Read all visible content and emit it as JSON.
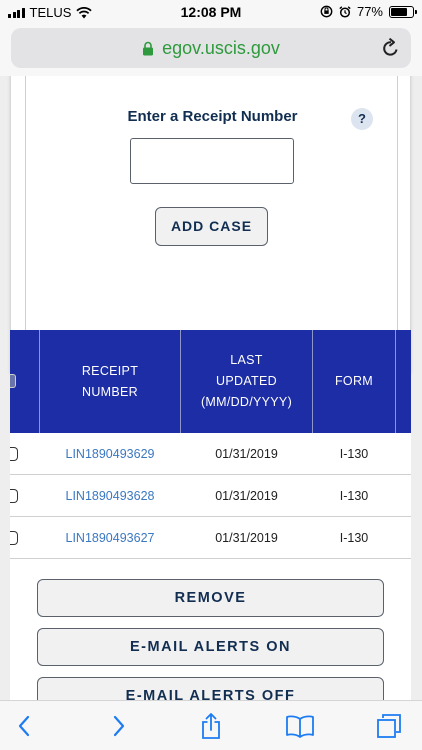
{
  "status_bar": {
    "carrier": "TELUS",
    "time": "12:08 PM",
    "battery_percent": "77%",
    "battery_level": 0.77
  },
  "browser": {
    "url": "egov.uscis.gov",
    "lock_icon": "lock-icon",
    "reload_icon": "reload-icon"
  },
  "add_case": {
    "label": "Enter a Receipt Number",
    "help": "?",
    "input_value": "",
    "button_label": "ADD CASE"
  },
  "table": {
    "headers": {
      "receipt_line1": "RECEIPT",
      "receipt_line2": "NUMBER",
      "updated_line1": "LAST",
      "updated_line2": "UPDATED",
      "updated_line3": "(MM/DD/YYYY)",
      "form": "FORM"
    },
    "rows": [
      {
        "receipt": "LIN1890493629",
        "updated": "01/31/2019",
        "form": "I-130"
      },
      {
        "receipt": "LIN1890493628",
        "updated": "01/31/2019",
        "form": "I-130"
      },
      {
        "receipt": "LIN1890493627",
        "updated": "01/31/2019",
        "form": "I-130"
      }
    ]
  },
  "actions": {
    "remove": "REMOVE",
    "email_on": "E-MAIL ALERTS ON",
    "email_off": "E-MAIL ALERTS OFF"
  },
  "toolbar": {
    "icons": [
      "back-icon",
      "forward-icon",
      "share-icon",
      "bookmarks-icon",
      "tabs-icon"
    ]
  },
  "colors": {
    "header_blue": "#1c2da6",
    "link_blue": "#3a78c2",
    "navy_text": "#112e51",
    "url_green": "#2e9a3d",
    "ios_blue": "#1d7cf2"
  }
}
